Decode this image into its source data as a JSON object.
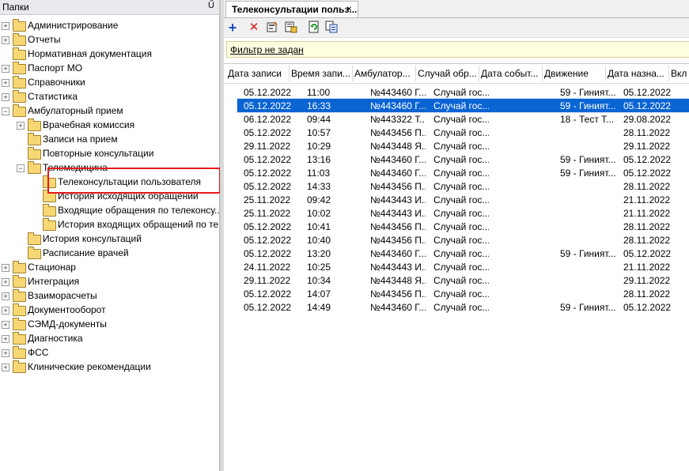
{
  "left_panel": {
    "title": "Папки",
    "pin": "Ű"
  },
  "tree": {
    "administration": "Администрирование",
    "reports": "Отчеты",
    "normative_docs": "Нормативная документация",
    "passport": "Паспорт МО",
    "directories": "Справочники",
    "statistics": "Статистика",
    "ambulatory": "Амбулаторный прием",
    "medical_commission": "Врачебная комиссия",
    "appointments": "Записи на прием",
    "repeat_consults": "Повторные консультации",
    "telemedicine": "Телемедицина",
    "user_teleconsults": "Телеконсультации пользователя",
    "outgoing_history": "История исходящих обращений",
    "incoming_teleconsults": "Входящие обращения по телеконсу...",
    "incoming_history": "История входящих обращений по те...",
    "consult_history": "История консультаций",
    "doctor_schedule": "Расписание врачей",
    "hospital": "Стационар",
    "integration": "Интеграция",
    "settlements": "Взаиморасчеты",
    "document_flow": "Документооборот",
    "semd": "СЭМД-документы",
    "diagnostics": "Диагностика",
    "fss": "ФСС",
    "clinical_recs": "Клинические рекомендации"
  },
  "tab": {
    "label": "Телеконсультации польз...",
    "close": "×"
  },
  "toolbar": {
    "add": "+",
    "delete": "✕"
  },
  "filter": {
    "label": "Фильтр не задан"
  },
  "grid": {
    "headers": [
      "Дата записи",
      "Время запи...",
      "Амбулатор...",
      "Случай обр...",
      "Дата событ...",
      "Движение",
      "Дата назна...",
      "Вкл"
    ],
    "rows": [
      [
        "05.12.2022",
        "11:00",
        "№443460 Г...",
        "Случай гос...",
        "",
        "59 - Гиният...",
        "05.12.2022"
      ],
      [
        "05.12.2022",
        "16:33",
        "№443460 Г...",
        "Случай гос...",
        "",
        "59 - Гиният...",
        "05.12.2022"
      ],
      [
        "06.12.2022",
        "09:44",
        "№443322 Т...",
        "Случай гос...",
        "",
        "18 - Тест Т...",
        "29.08.2022"
      ],
      [
        "05.12.2022",
        "10:57",
        "№443456 П...",
        "Случай гос...",
        "",
        "",
        "28.11.2022"
      ],
      [
        "29.11.2022",
        "10:29",
        "№443448 Я...",
        "Случай гос...",
        "",
        "",
        "29.11.2022"
      ],
      [
        "05.12.2022",
        "13:16",
        "№443460 Г...",
        "Случай гос...",
        "",
        "59 - Гиният...",
        "05.12.2022"
      ],
      [
        "05.12.2022",
        "11:03",
        "№443460 Г...",
        "Случай гос...",
        "",
        "59 - Гиният...",
        "05.12.2022"
      ],
      [
        "05.12.2022",
        "14:33",
        "№443456 П...",
        "Случай гос...",
        "",
        "",
        "28.11.2022"
      ],
      [
        "25.11.2022",
        "09:42",
        "№443443 И...",
        "Случай гос...",
        "",
        "",
        "21.11.2022"
      ],
      [
        "25.11.2022",
        "10:02",
        "№443443 И...",
        "Случай гос...",
        "",
        "",
        "21.11.2022"
      ],
      [
        "05.12.2022",
        "10:41",
        "№443456 П...",
        "Случай гос...",
        "",
        "",
        "28.11.2022"
      ],
      [
        "05.12.2022",
        "10:40",
        "№443456 П...",
        "Случай гос...",
        "",
        "",
        "28.11.2022"
      ],
      [
        "05.12.2022",
        "13:20",
        "№443460 Г...",
        "Случай гос...",
        "",
        "59 - Гиният...",
        "05.12.2022"
      ],
      [
        "24.11.2022",
        "10:25",
        "№443443 И...",
        "Случай гос...",
        "",
        "",
        "21.11.2022"
      ],
      [
        "29.11.2022",
        "10:34",
        "№443448 Я...",
        "Случай гос...",
        "",
        "",
        "29.11.2022"
      ],
      [
        "05.12.2022",
        "14:07",
        "№443456 П...",
        "Случай гос...",
        "",
        "",
        "28.11.2022"
      ],
      [
        "05.12.2022",
        "14:49",
        "№443460 Г...",
        "Случай гос...",
        "",
        "59 - Гиният...",
        "05.12.2022"
      ]
    ],
    "selected_row": 1
  },
  "colors": {
    "selection": "#0a64d2",
    "highlight_box": "#e8181c",
    "filter_bg": "#fffde0"
  }
}
